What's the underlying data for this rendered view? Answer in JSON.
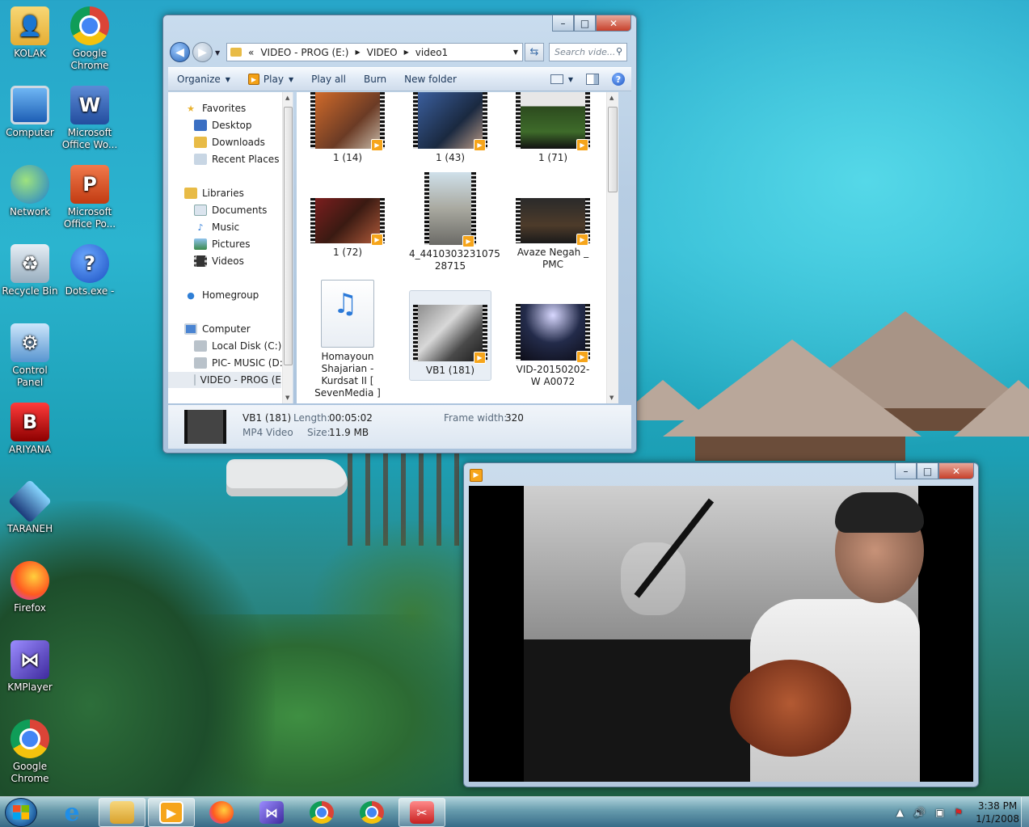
{
  "desktop": {
    "icons": [
      {
        "label": "KOLAK",
        "icon": "folder-user-icon"
      },
      {
        "label": "Google Chrome",
        "icon": "chrome-icon"
      },
      {
        "label": "Computer",
        "icon": "computer-icon"
      },
      {
        "label": "Microsoft Office Wo...",
        "icon": "word-icon"
      },
      {
        "label": "Network",
        "icon": "network-icon"
      },
      {
        "label": "Microsoft Office Po...",
        "icon": "powerpoint-icon"
      },
      {
        "label": "Recycle Bin",
        "icon": "recycle-bin-icon"
      },
      {
        "label": "Dots.exe -",
        "icon": "help-icon"
      },
      {
        "label": "Control Panel",
        "icon": "control-panel-icon"
      },
      {
        "label": "ARIYANA",
        "icon": "ariyana-icon"
      },
      {
        "label": "TARANEH",
        "icon": "taraneh-icon"
      },
      {
        "label": "Firefox",
        "icon": "firefox-icon"
      },
      {
        "label": "KMPlayer",
        "icon": "kmplayer-icon"
      },
      {
        "label": "Google Chrome",
        "icon": "chrome-icon"
      }
    ]
  },
  "explorer": {
    "address": {
      "chevron": "«",
      "segments": [
        "VIDEO - PROG (E:)",
        "VIDEO",
        "video1"
      ]
    },
    "search_placeholder": "Search vide...",
    "toolbar": {
      "organize": "Organize",
      "play": "Play",
      "play_all": "Play all",
      "burn": "Burn",
      "new_folder": "New folder"
    },
    "nav": {
      "favorites": "Favorites",
      "desktop": "Desktop",
      "downloads": "Downloads",
      "recent_places": "Recent Places",
      "libraries": "Libraries",
      "documents": "Documents",
      "music": "Music",
      "pictures": "Pictures",
      "videos": "Videos",
      "homegroup": "Homegroup",
      "computer": "Computer",
      "local_disk": "Local Disk (C:)",
      "pic_music": "PIC- MUSIC (D:)",
      "video_prog": "VIDEO - PROG (E"
    },
    "files": [
      {
        "name": "1 (14)"
      },
      {
        "name": "1 (43)"
      },
      {
        "name": "1 (71)"
      },
      {
        "name": "1 (72)"
      },
      {
        "name": "4_4410303231075 28715"
      },
      {
        "name": "Avaze Negah _ PMC"
      },
      {
        "name": "Homayoun Shajarian - Kurdsat II [ SevenMedia ]"
      },
      {
        "name": "VB1 (181)"
      },
      {
        "name": "VID-20150202-W A0072"
      }
    ],
    "details": {
      "name": "VB1 (181)",
      "type": "MP4 Video",
      "length_label": "Length:",
      "length": "00:05:02",
      "size_label": "Size:",
      "size": "11.9 MB",
      "frame_width_label": "Frame width:",
      "frame_width": "320"
    }
  },
  "window_controls": {
    "minimize": "–",
    "maximize": "□",
    "close": "✕"
  },
  "taskbar": {
    "clock_time": "3:38 PM",
    "clock_date": "1/1/2008"
  },
  "colors": {
    "accent": "#f6a51b",
    "window_frame": "#b7cde3",
    "selection": "#e8eef5"
  }
}
